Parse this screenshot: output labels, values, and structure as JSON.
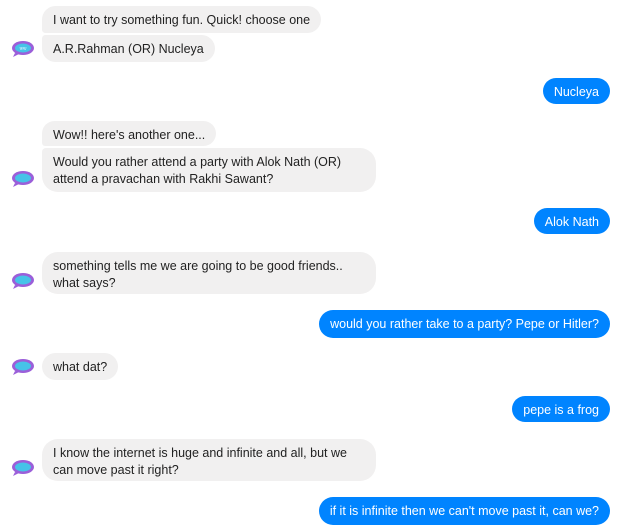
{
  "colors": {
    "bot_bubble": "#f1f0f0",
    "bot_text": "#222222",
    "user_bubble": "#0084ff",
    "user_text": "#ffffff",
    "avatar_primary": "#9b5fd9",
    "avatar_accent": "#46c3e8"
  },
  "avatar": {
    "icon": "bot-logo-icon"
  },
  "messages": [
    {
      "sender": "bot",
      "text": "I want to try something fun. Quick! choose one"
    },
    {
      "sender": "bot",
      "text": "A.R.Rahman (OR) Nucleya"
    },
    {
      "sender": "user",
      "text": "Nucleya"
    },
    {
      "sender": "bot",
      "text": "Wow!! here's another one..."
    },
    {
      "sender": "bot",
      "line1": "Would you rather attend a party with Alok Nath (OR)",
      "line2": "attend a pravachan with Rakhi Sawant?"
    },
    {
      "sender": "user",
      "text": "Alok Nath"
    },
    {
      "sender": "bot",
      "line1": "something tells me we are going to be good friends..",
      "line2": "what says?"
    },
    {
      "sender": "user",
      "text": "would you rather take to a party? Pepe or Hitler?"
    },
    {
      "sender": "bot",
      "text": "what dat?"
    },
    {
      "sender": "user",
      "text": "pepe is a frog"
    },
    {
      "sender": "bot",
      "line1": "I know the internet is huge and infinite and all, but we",
      "line2": "can move past it right?"
    },
    {
      "sender": "user",
      "text": "if it is infinite then we can't move past it, can we?"
    }
  ]
}
